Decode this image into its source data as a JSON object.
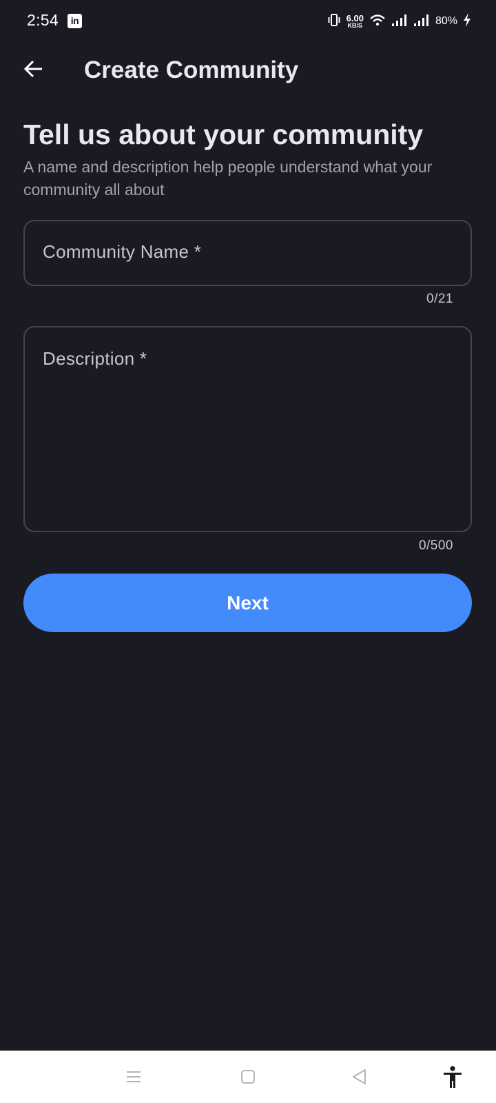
{
  "status_bar": {
    "time": "2:54",
    "app_icon": "linkedin-icon",
    "app_icon_text": "in",
    "net_speed_value": "6.00",
    "net_speed_unit": "KB/S",
    "battery": "80%",
    "icons": [
      "vibrate-icon",
      "wifi-icon",
      "signal-icon",
      "signal-icon",
      "charging-bolt-icon"
    ]
  },
  "app_bar": {
    "back_icon": "arrow-left-icon",
    "title": "Create Community"
  },
  "main": {
    "headline": "Tell us about your community",
    "subtext": "A name and description help people understand what your community all about",
    "name_field": {
      "placeholder": "Community Name *",
      "value": "",
      "counter": "0/21"
    },
    "description_field": {
      "placeholder": "Description *",
      "value": "",
      "counter": "0/500"
    },
    "next_label": "Next"
  },
  "nav_bar": {
    "items": [
      "menu-icon",
      "home-square-icon",
      "back-triangle-icon",
      "accessibility-icon"
    ]
  },
  "colors": {
    "background": "#191a22",
    "accent": "#438bfb",
    "text_primary": "#ebe7ef",
    "text_secondary": "#a3a1ab",
    "field_border": "#44454f"
  }
}
